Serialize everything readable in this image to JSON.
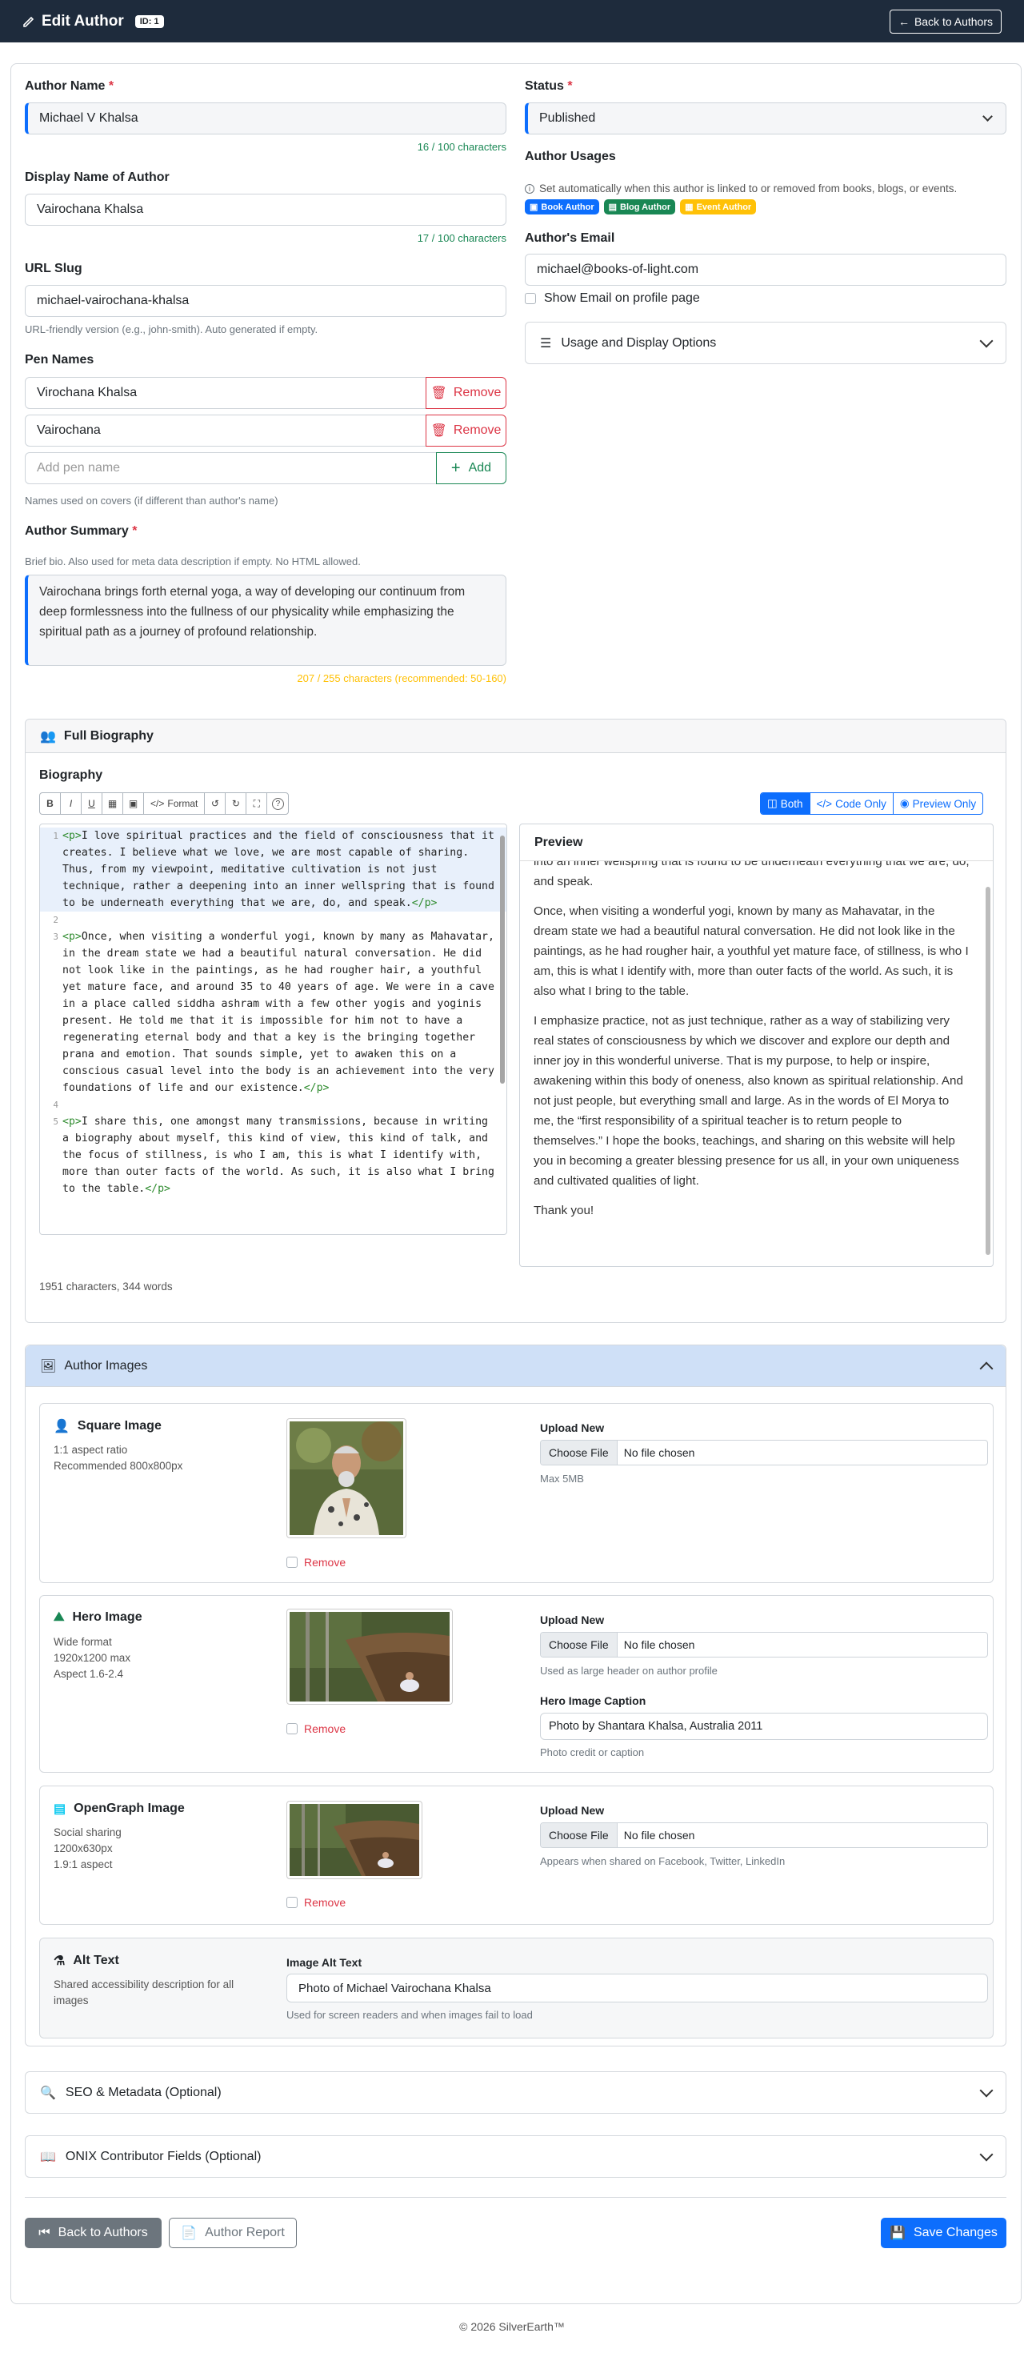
{
  "header": {
    "title": "Edit Author",
    "id_badge": "ID: 1",
    "back_button": "Back to Authors"
  },
  "author_name": {
    "label": "Author Name",
    "value": "Michael V Khalsa",
    "counter": "16 / 100 characters"
  },
  "display_name": {
    "label": "Display Name of Author",
    "value": "Vairochana Khalsa",
    "counter": "17 / 100 characters"
  },
  "url_slug": {
    "label": "URL Slug",
    "value": "michael-vairochana-khalsa",
    "help": "URL-friendly version (e.g., john-smith). Auto generated if empty."
  },
  "pen_names": {
    "label": "Pen Names",
    "items": [
      {
        "value": "Virochana Khalsa",
        "remove": "Remove"
      },
      {
        "value": "Vairochana",
        "remove": "Remove"
      }
    ],
    "placeholder": "Add pen name",
    "add_label": "Add",
    "help": "Names used on covers (if different than author's name)"
  },
  "summary": {
    "label": "Author Summary",
    "help": "Brief bio. Also used for meta data description if empty. No HTML allowed.",
    "value": "Vairochana brings forth eternal yoga, a way of developing our continuum from deep formlessness into the fullness of our physicality while emphasizing the spiritual path as a journey of profound relationship.",
    "counter": "207 / 255 characters (recommended: 50-160)"
  },
  "status": {
    "label": "Status",
    "value": "Published"
  },
  "usages": {
    "label": "Author Usages",
    "help": "Set automatically when this author is linked to or removed from books, blogs, or events.",
    "badges": [
      {
        "label": "Book Author",
        "color": "#0d6efd"
      },
      {
        "label": "Blog Author",
        "color": "#198754"
      },
      {
        "label": "Event Author",
        "color": "#ffc107"
      }
    ]
  },
  "email": {
    "label": "Author's Email",
    "value": "michael@books-of-light.com",
    "show_label": "Show Email on profile page"
  },
  "usage_display": {
    "label": "Usage and Display Options"
  },
  "biography": {
    "section_title": "Full Biography",
    "label": "Biography",
    "toolbar": {
      "bold": "B",
      "italic": "I",
      "underline": "U",
      "format": "Format",
      "help": "?"
    },
    "modes": {
      "both": "Both",
      "code": "Code Only",
      "preview": "Preview Only"
    },
    "code_lines": [
      {
        "n": "1",
        "open": "<p>",
        "text": "I love spiritual practices and the field of consciousness that it creates. I believe what we love, we are most capable of sharing. Thus, from my viewpoint, meditative cultivation is not just technique, rather a deepening into an inner wellspring that is found to be underneath everything that we are, do, and speak.",
        "close": "</p>"
      },
      {
        "n": "2",
        "open": "",
        "text": "",
        "close": ""
      },
      {
        "n": "3",
        "open": "<p>",
        "text": "Once, when visiting a wonderful yogi, known by many as Mahavatar, in the dream state we had a beautiful natural conversation. He did not look like in the paintings, as he had rougher hair, a youthful yet mature face, and around 35 to 40 years of age. We were in a cave in a place called siddha ashram with a few other yogis and yoginis present. He told me that it is impossible for him not to have a regenerating eternal body and that a key is the bringing together prana and emotion. That sounds simple, yet to awaken this on a conscious casual level into the body is an achievement into the very foundations of life and our existence.",
        "close": "</p>"
      },
      {
        "n": "4",
        "open": "",
        "text": "",
        "close": ""
      },
      {
        "n": "5",
        "open": "<p>",
        "text": "I share this, one amongst many transmissions, because in writing a biography about myself, this kind of view, this kind of talk, and the focus of stillness, is who I am, this is what I identify with, more than outer facts of the world. As such, it is also what I bring to the table.",
        "close": "</p>"
      }
    ],
    "preview_title": "Preview",
    "preview_paragraphs": [
      "into an inner wellspring that is found to be underneath everything that we are, do, and speak.",
      "Once, when visiting a wonderful yogi, known by many as Mahavatar, in the dream state we had a beautiful natural conversation. He did not look like in the paintings, as he had rougher hair, a youthful yet mature face, of stillness, is who I am, this is what I identify with, more than outer facts of the world. As such, it is also what I bring to the table.",
      "I emphasize practice, not as just technique, rather as a way of stabilizing very real states of consciousness by which we discover and explore our depth and inner joy in this wonderful universe. That is my purpose, to help or inspire, awakening within this body of oneness, also known as spiritual relationship. And not just people, but everything small and large. As in the words of El Morya to me, the “first responsibility of a spiritual teacher is to return people to themselves.” I hope the books, teachings, and sharing on this website will help you in becoming a greater blessing presence for us all, in your own uniqueness and cultivated qualities of light.",
      "Thank you!"
    ],
    "stats": "1951 characters, 344 words"
  },
  "images": {
    "section_title": "Author Images",
    "square": {
      "title": "Square Image",
      "desc": [
        "1:1 aspect ratio",
        "Recommended 800x800px"
      ],
      "remove": "Remove",
      "upload_label": "Upload New",
      "choose": "Choose File",
      "no_file": "No file chosen",
      "help": "Max 5MB"
    },
    "hero": {
      "title": "Hero Image",
      "desc": [
        "Wide format",
        "1920x1200 max",
        "Aspect 1.6-2.4"
      ],
      "remove": "Remove",
      "upload_label": "Upload New",
      "choose": "Choose File",
      "no_file": "No file chosen",
      "help": "Used as large header on author profile",
      "caption_label": "Hero Image Caption",
      "caption_value": "Photo by Shantara Khalsa, Australia 2011",
      "caption_help": "Photo credit or caption"
    },
    "og": {
      "title": "OpenGraph Image",
      "desc": [
        "Social sharing",
        "1200x630px",
        "1.9:1 aspect"
      ],
      "remove": "Remove",
      "upload_label": "Upload New",
      "choose": "Choose File",
      "no_file": "No file chosen",
      "help": "Appears when shared on Facebook, Twitter, LinkedIn"
    },
    "alt": {
      "title": "Alt Text",
      "desc": "Shared accessibility description for all images",
      "field_label": "Image Alt Text",
      "value": "Photo of Michael Vairochana Khalsa",
      "help": "Used for screen readers and when images fail to load"
    }
  },
  "seo": {
    "label": "SEO & Metadata (Optional)"
  },
  "onix": {
    "label": "ONIX Contributor Fields (Optional)"
  },
  "footer_buttons": {
    "back": "Back to Authors",
    "report": "Author Report",
    "save": "Save Changes"
  },
  "footer": {
    "copyright": "© 2026 SilverEarth™"
  }
}
